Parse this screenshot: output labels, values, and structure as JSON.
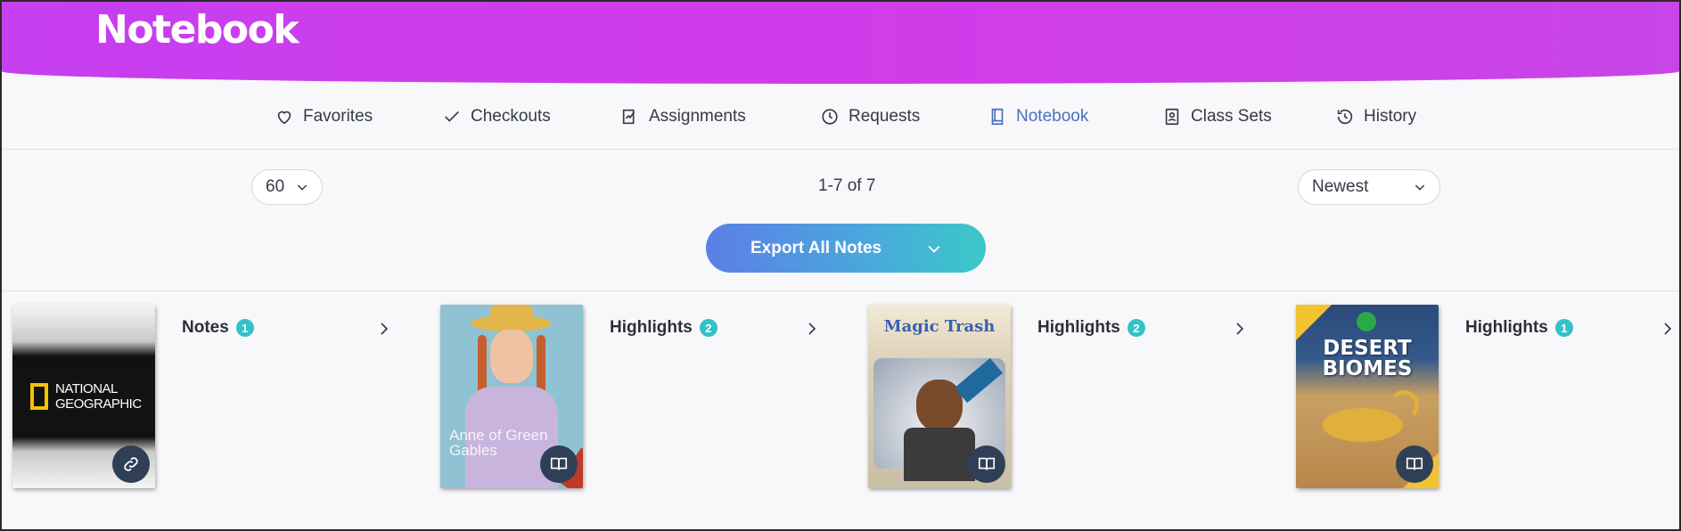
{
  "header": {
    "title": "Notebook"
  },
  "tabs": [
    {
      "label": "Favorites",
      "icon": "heart-icon"
    },
    {
      "label": "Checkouts",
      "icon": "check-icon"
    },
    {
      "label": "Assignments",
      "icon": "assignment-icon"
    },
    {
      "label": "Requests",
      "icon": "clock-icon"
    },
    {
      "label": "Notebook",
      "icon": "book-icon",
      "active": true
    },
    {
      "label": "Class Sets",
      "icon": "class-sets-icon"
    },
    {
      "label": "History",
      "icon": "history-icon"
    }
  ],
  "toolbar": {
    "per_page": "60",
    "result_count": "1-7 of 7",
    "sort": "Newest",
    "export_label": "Export All Notes"
  },
  "colors": {
    "header": "#d23be9",
    "accent": "#4a6fc0",
    "badge": "#33c2c8"
  },
  "cards": [
    {
      "label": "Notes",
      "count": "1",
      "cover_text": [
        "NATIONAL",
        "GEOGRAPHIC"
      ],
      "action_icon": "link-icon"
    },
    {
      "label": "Highlights",
      "count": "2",
      "cover_text": [
        "Anne of Green",
        "Gables"
      ],
      "action_icon": "open-book-icon"
    },
    {
      "label": "Highlights",
      "count": "2",
      "cover_text": [
        "Magic Trash"
      ],
      "action_icon": "open-book-icon"
    },
    {
      "label": "Highlights",
      "count": "1",
      "cover_text": [
        "DESERT",
        "BIOMES"
      ],
      "action_icon": "open-book-icon"
    }
  ]
}
